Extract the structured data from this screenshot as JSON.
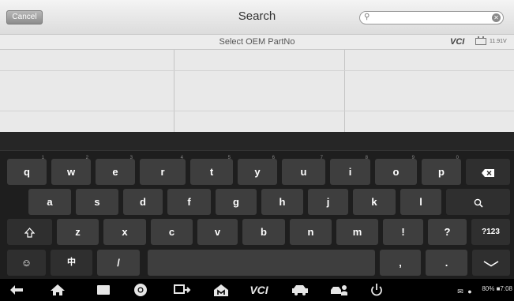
{
  "header": {
    "cancel_label": "Cancel",
    "title": "Search",
    "search_placeholder": "",
    "search_value": ""
  },
  "subheader": {
    "title": "Select OEM PartNo",
    "vci_label": "VCI",
    "voltage": "11.91V"
  },
  "keyboard": {
    "row1": [
      {
        "label": "q",
        "hint": "1"
      },
      {
        "label": "w",
        "hint": "2"
      },
      {
        "label": "e",
        "hint": "3"
      },
      {
        "label": "r",
        "hint": "4"
      },
      {
        "label": "t",
        "hint": "5"
      },
      {
        "label": "y",
        "hint": "6"
      },
      {
        "label": "u",
        "hint": "7"
      },
      {
        "label": "i",
        "hint": "8"
      },
      {
        "label": "o",
        "hint": "9"
      },
      {
        "label": "p",
        "hint": "0"
      }
    ],
    "row2": [
      "a",
      "s",
      "d",
      "f",
      "g",
      "h",
      "j",
      "k",
      "l"
    ],
    "row3": [
      "z",
      "x",
      "c",
      "v",
      "b",
      "n",
      "m",
      "!",
      "?"
    ],
    "numbers_label": "?123",
    "emoji_label": "☺",
    "lang_label": "中",
    "slash_label": "/",
    "comma_label": ",",
    "period_label": "."
  },
  "systembar": {
    "status": "80% ■7:08"
  }
}
